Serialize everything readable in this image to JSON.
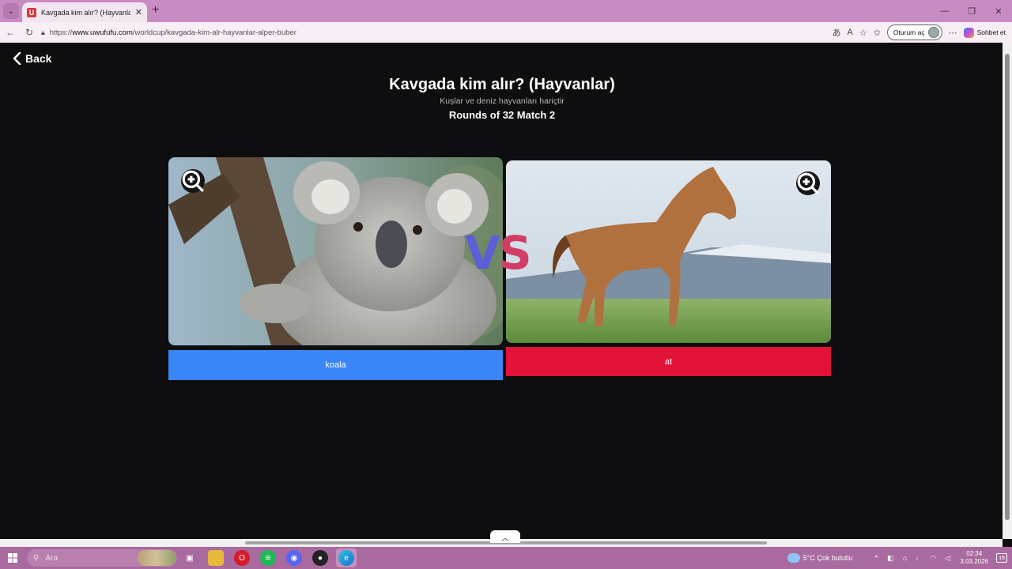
{
  "browser": {
    "tab_title": "Kavgada kim alır? (Hayvanlar) | Uw",
    "favicon_letter": "U",
    "url_prefix": "https://",
    "url_domain": "www.uwufufu.com",
    "url_path": "/worldcup/kavgada-kim-alr-hayvanlar-alper-buber",
    "signin_label": "Oturum aç",
    "copilot_label": "Sohbet et"
  },
  "page": {
    "back_label": "Back",
    "title": "Kavgada kim alır? (Hayvanlar)",
    "subtitle": "Kuşlar ve deniz hayvanları hariçtir",
    "round": "Rounds of 32 Match 2",
    "vs_v": "V",
    "vs_s": "S"
  },
  "match": {
    "left": {
      "label": "koala",
      "color": "#3a86f6",
      "image": "koala-on-tree"
    },
    "right": {
      "label": "at",
      "color": "#e21238",
      "image": "brown-horse-in-field"
    }
  },
  "taskbar": {
    "search_placeholder": "Ara",
    "weather": "5°C  Çok bulutlu",
    "weather_badge": "5",
    "time": "02:34",
    "date": "3.03.2026",
    "notif_count": "19"
  }
}
